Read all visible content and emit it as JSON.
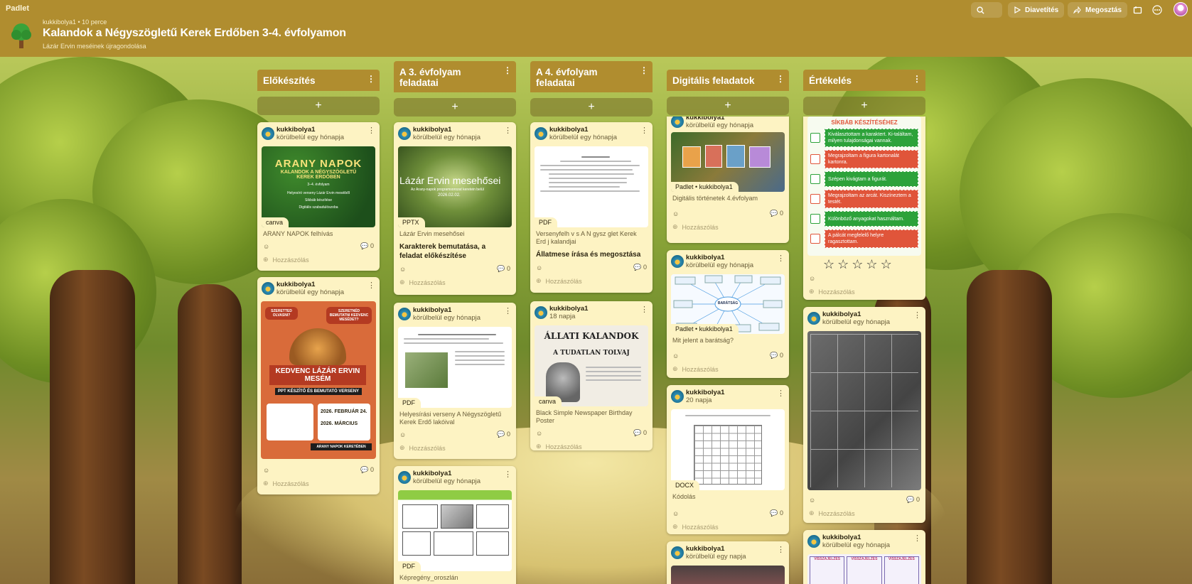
{
  "app": {
    "brand": "Padlet"
  },
  "header": {
    "meta": "kukkibolya1 • 10 perce",
    "title": "Kalandok a Négyszögletű Kerek Erdőben 3-4. évfolyamon",
    "subtitle": "Lázár Ervin meséinek újragondolása",
    "slideshow_label": "Diavetítés",
    "share_label": "Megosztás",
    "icons": [
      "search-icon",
      "play-icon",
      "share-icon",
      "remake-icon",
      "more-icon"
    ]
  },
  "columns": [
    {
      "title": "Előkészítés",
      "cards": [
        {
          "author": "kukkibolya1",
          "time": "körülbelül egy hónapja",
          "thumb_lines": [
            "ARANY NAPOK",
            "KALANDOK A NÉGYSZÖGLETŰ",
            "KEREK ERDŐBEN",
            "3–4. évfolyam",
            "Helyesíró verseny Lázár Ervin meséiből",
            "Síkbáb készítése",
            "Digitális szabadulószoba"
          ],
          "tag": "canva",
          "caption": "ARANY NAPOK felhívás",
          "comments": "0",
          "add_comment": "Hozzászólás"
        },
        {
          "author": "kukkibolya1",
          "time": "körülbelül egy hónapja",
          "thumb_lines": [
            "SZERETTED OLVASNI?",
            "SZERETNÉD BEMUTATNI KEDVENC MESÉDET?",
            "KEDVENC LÁZÁR ERVIN MESÉM",
            "PPT KÉSZÍTŐ ÉS BEMUTATÓ VERSENY",
            "2026. FEBRUÁR 24.",
            "2026. MÁRCIUS",
            "ARANY NAPOK KERETÉBEN"
          ],
          "comments": "0",
          "add_comment": "Hozzászólás"
        }
      ]
    },
    {
      "title": "A 3. évfolyam feladatai",
      "cards": [
        {
          "author": "kukkibolya1",
          "time": "körülbelül egy hónapja",
          "thumb_lines": [
            "Lázár Ervin mesehősei",
            "Az Arany-napok programsorozat keretein belül",
            "2026.02.02."
          ],
          "tag": "PPTX",
          "caption": "Lázár Ervin mesehősei",
          "title": "Karakterek bemutatása, a feladat előkészítése",
          "comments": "0",
          "add_comment": "Hozzászólás"
        },
        {
          "author": "kukkibolya1",
          "time": "körülbelül egy hónapja",
          "tag": "PDF",
          "caption": "Helyesírási verseny A Négyszögletű Kerek Erdő lakóival",
          "comments": "0",
          "add_comment": "Hozzászólás"
        },
        {
          "author": "kukkibolya1",
          "time": "körülbelül egy hónapja",
          "tag": "PDF",
          "caption": "Képregény_oroszlán"
        }
      ]
    },
    {
      "title": "A 4. évfolyam feladatai",
      "cards": [
        {
          "author": "kukkibolya1",
          "time": "körülbelül egy hónapja",
          "tag": "PDF",
          "caption": "Versenyfelh v s A N gysz glet Kerek Erd j kalandjai",
          "title": "Állatmese írása és megosztása",
          "comments": "0",
          "add_comment": "Hozzászólás"
        },
        {
          "author": "kukkibolya1",
          "time": "18 napja",
          "thumb_lines": [
            "ÁLLATI KALANDOK",
            "A TUDATLAN TOLVAJ"
          ],
          "tag": "canva",
          "caption": "Black Simple Newspaper Birthday Poster",
          "comments": "0",
          "add_comment": "Hozzászólás"
        }
      ]
    },
    {
      "title": "Digitális feladatok",
      "cards": [
        {
          "author": "kukkibolya1",
          "time": "körülbelül egy hónapja",
          "tag": "Padlet • kukkibolya1",
          "caption": "Digitális történetek 4.évfolyam",
          "comments": "0",
          "add_comment": "Hozzászólás"
        },
        {
          "author": "kukkibolya1",
          "time": "körülbelül egy hónapja",
          "thumb_lines": [
            "BARÁTSÁG"
          ],
          "tag": "Padlet • kukkibolya1",
          "caption": "Mit jelent a barátság?",
          "comments": "0",
          "add_comment": "Hozzászólás"
        },
        {
          "author": "kukkibolya1",
          "time": "20 napja",
          "tag": "DOCX",
          "caption": "Kódolás",
          "comments": "0",
          "add_comment": "Hozzászólás"
        },
        {
          "author": "kukkibolya1",
          "time": "körülbelül egy napja"
        }
      ]
    },
    {
      "title": "Értékelés",
      "cards": [
        {
          "checklist_title": "SÍKBÁB KÉSZÍTÉSÉHEZ",
          "checklist": [
            {
              "text": "Kiválasztottam a karaktert. Ki-találtam, milyen tulajdonságai vannak.",
              "color": "#2da23a"
            },
            {
              "text": "Megrajzoltam a figura kartonalát kartonra.",
              "color": "#e0553a"
            },
            {
              "text": "Szépen kivágtam a figurát.",
              "color": "#2da23a"
            },
            {
              "text": "Megrajzoltam az arcát. Kiszíneztem a testét.",
              "color": "#e0553a"
            },
            {
              "text": "Különböző anyagokat használtam.",
              "color": "#2da23a"
            },
            {
              "text": "A pálcát megfelelő helyre ragasztottam.",
              "color": "#e0553a"
            }
          ],
          "add_comment": "Hozzászólás"
        },
        {
          "author": "kukkibolya1",
          "time": "körülbelül egy hónapja",
          "comments": "0",
          "add_comment": "Hozzászólás"
        },
        {
          "author": "kukkibolya1",
          "time": "körülbelül egy hónapja",
          "thumb_lines": [
            "VISSZAJELZÉS",
            "VISSZAJELZÉS",
            "VISSZAJELZÉS"
          ]
        }
      ]
    }
  ],
  "colors": {
    "header": "#b08d2f",
    "card": "#fdf3c3",
    "add_bar": "#7a6e28"
  }
}
